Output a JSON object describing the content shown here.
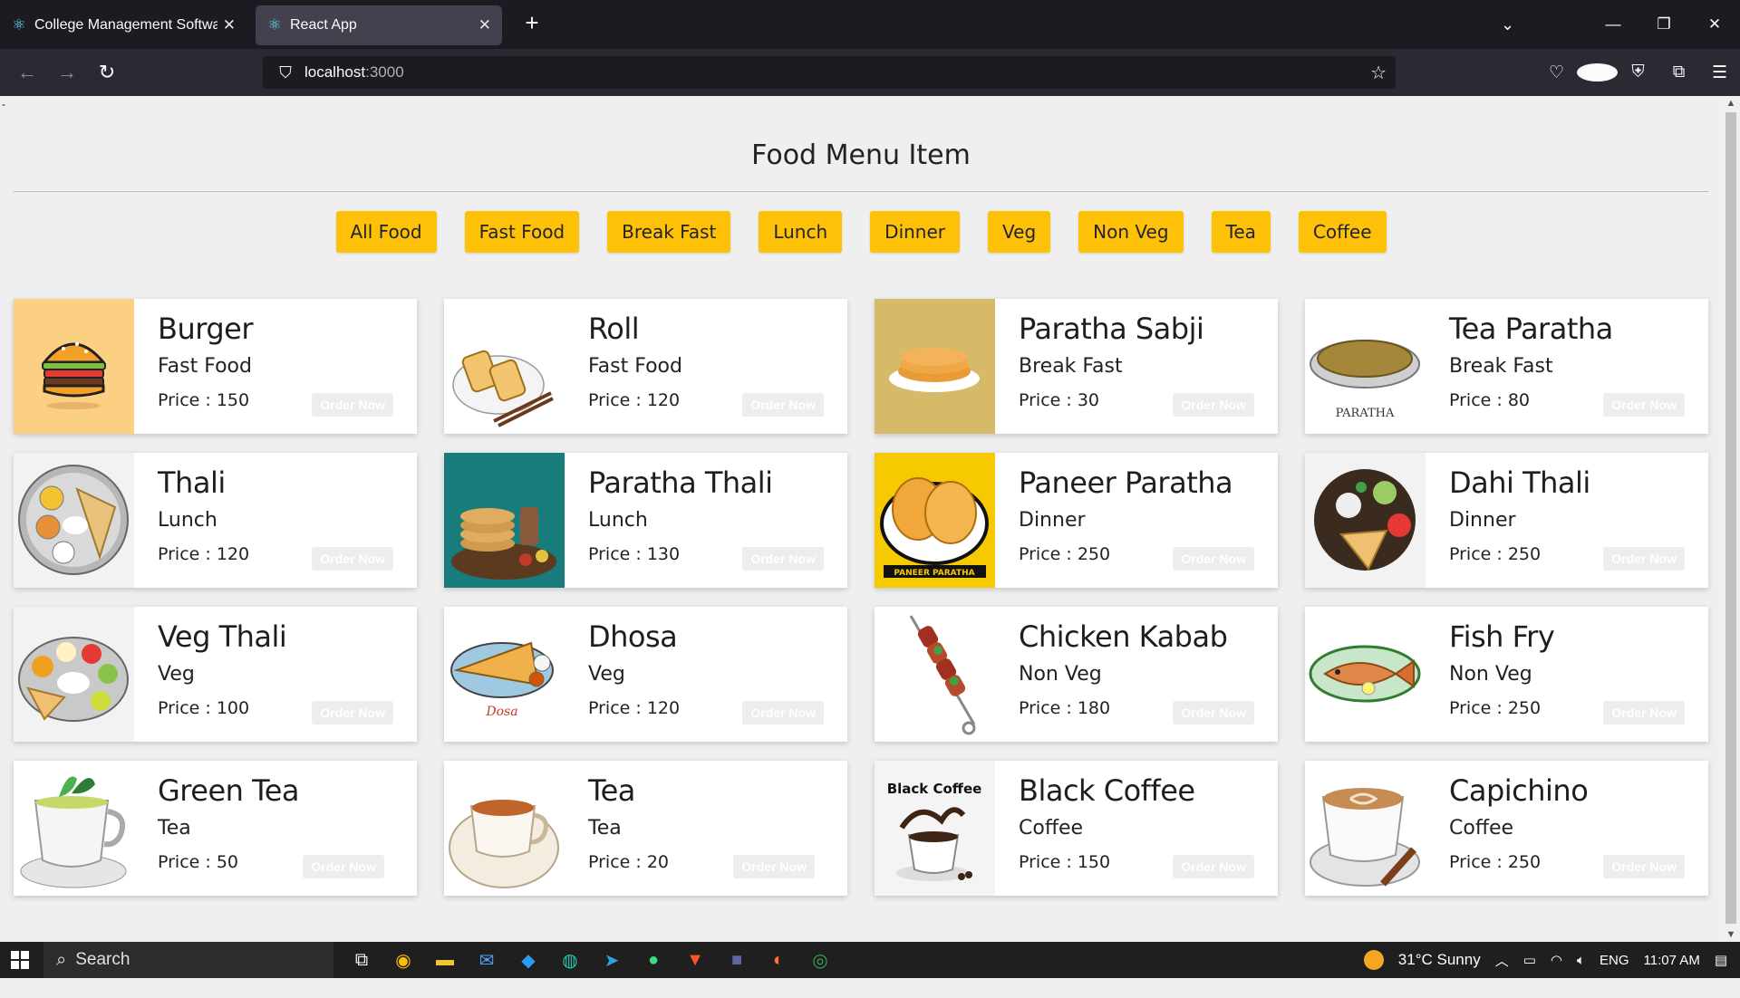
{
  "browser": {
    "tabs": [
      {
        "title": "College Management Software",
        "active": false
      },
      {
        "title": "React App",
        "active": true
      }
    ],
    "url_host": "localhost",
    "url_port": ":3000"
  },
  "page": {
    "dash": "-",
    "heading": "Food Menu Item",
    "filters": [
      "All Food",
      "Fast Food",
      "Break Fast",
      "Lunch",
      "Dinner",
      "Veg",
      "Non Veg",
      "Tea",
      "Coffee"
    ],
    "order_label": "Order Now",
    "items": [
      {
        "name": "Burger",
        "category": "Fast Food",
        "price": "Price : 150"
      },
      {
        "name": "Roll",
        "category": "Fast Food",
        "price": "Price : 120"
      },
      {
        "name": "Paratha Sabji",
        "category": "Break Fast",
        "price": "Price : 30"
      },
      {
        "name": "Tea Paratha",
        "category": "Break Fast",
        "price": "Price : 80",
        "image_text": "PARATHA"
      },
      {
        "name": "Thali",
        "category": "Lunch",
        "price": "Price : 120"
      },
      {
        "name": "Paratha Thali",
        "category": "Lunch",
        "price": "Price : 130"
      },
      {
        "name": "Paneer Paratha",
        "category": "Dinner",
        "price": "Price : 250",
        "image_text": "PANEER PARATHA"
      },
      {
        "name": "Dahi Thali",
        "category": "Dinner",
        "price": "Price : 250"
      },
      {
        "name": "Veg Thali",
        "category": "Veg",
        "price": "Price : 100"
      },
      {
        "name": "Dhosa",
        "category": "Veg",
        "price": "Price : 120",
        "image_text": "Dosa"
      },
      {
        "name": "Chicken Kabab",
        "category": "Non Veg",
        "price": "Price : 180"
      },
      {
        "name": "Fish Fry",
        "category": "Non Veg",
        "price": "Price : 250"
      },
      {
        "name": "Green Tea",
        "category": "Tea",
        "price": "Price : 50"
      },
      {
        "name": "Tea",
        "category": "Tea",
        "price": "Price : 20"
      },
      {
        "name": "Black Coffee",
        "category": "Coffee",
        "price": "Price : 150",
        "image_text": "Black Coffee"
      },
      {
        "name": "Capichino",
        "category": "Coffee",
        "price": "Price : 250"
      }
    ]
  },
  "taskbar": {
    "search_label": "Search",
    "weather": "31°C  Sunny",
    "lang": "ENG",
    "time": "11:07 AM"
  },
  "colors": {
    "filter_button": "#ffc107",
    "page_bg": "#efefef",
    "browser_dark": "#1c1b22"
  }
}
